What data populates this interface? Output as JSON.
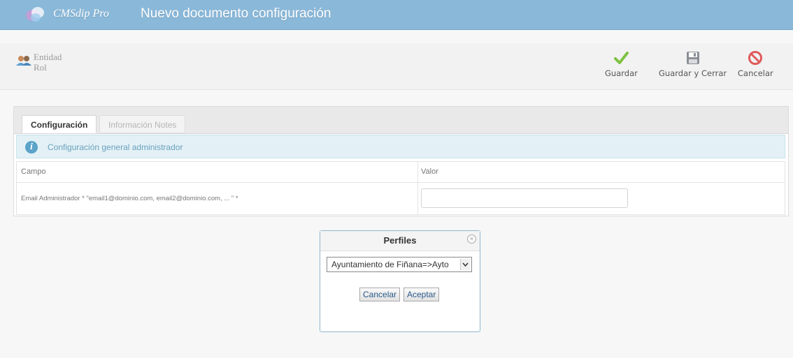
{
  "header": {
    "brand": "CMSdip Pro",
    "title": "Nuevo documento configuración"
  },
  "entity": {
    "line1": "Entidad",
    "line2": "Rol"
  },
  "toolbar": {
    "save_label": "Guardar",
    "save_close_label": "Guardar y Cerrar",
    "cancel_label": "Cancelar"
  },
  "tabs": {
    "active": "Configuración",
    "inactive": "Información Notes"
  },
  "info": {
    "text": "Configuración general administrador",
    "icon": "info-icon"
  },
  "table": {
    "headers": [
      "Campo",
      "Valor"
    ],
    "rows": [
      {
        "field": "Email Administrador * \"email1@dominio.com, email2@dominio.com, ... \" *",
        "value": ""
      }
    ]
  },
  "dialog": {
    "title": "Perfiles",
    "selected": "Ayuntamiento de Fiñana=>Ayto",
    "cancel_label": "Cancelar",
    "accept_label": "Aceptar"
  },
  "colors": {
    "header_bg": "#8ab8d9",
    "save_check": "#7fc243",
    "cancel_red": "#e05a5a",
    "info_blue": "#5ba3c9"
  }
}
